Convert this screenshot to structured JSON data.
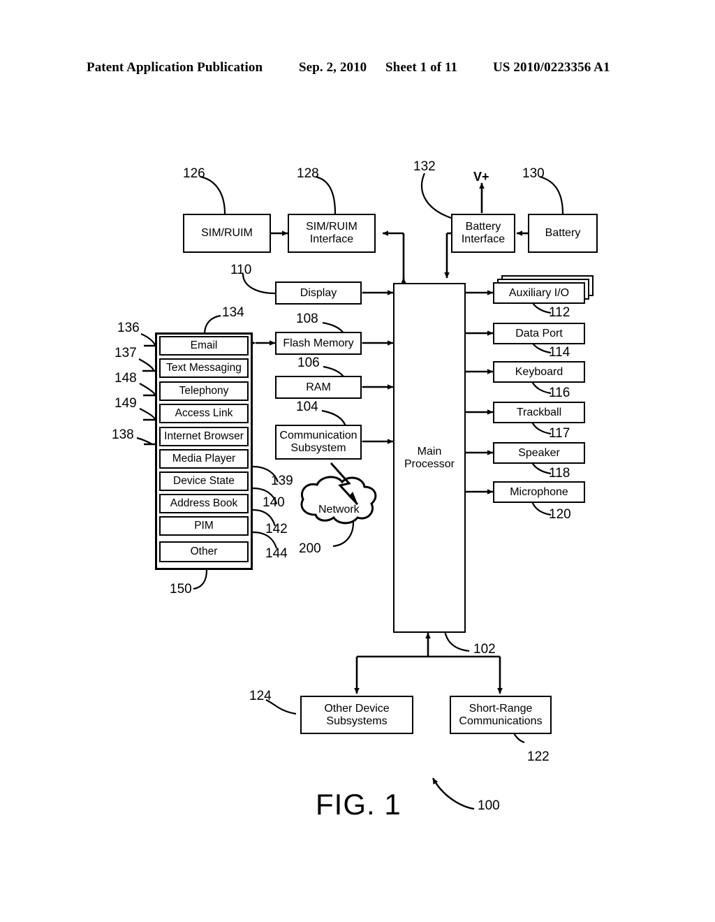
{
  "header": {
    "publication": "Patent Application Publication",
    "date": "Sep. 2, 2010",
    "sheet": "Sheet 1 of 11",
    "patent_number": "US 2010/0223356 A1"
  },
  "figure": {
    "caption": "FIG. 1",
    "caption_ref": "100",
    "v_plus_label": "V+",
    "cloud_label": "Network",
    "cloud_ref": "200"
  },
  "top_row": [
    {
      "label": "SIM/RUIM",
      "ref": "126"
    },
    {
      "label": "SIM/RUIM\nInterface",
      "ref": "128",
      "line1": "SIM/RUIM",
      "line2": "Interface"
    },
    {
      "label": "Battery\nInterface",
      "ref": "132",
      "line1": "Battery",
      "line2": "Interface"
    },
    {
      "label": "Battery",
      "ref": "130"
    }
  ],
  "processor": {
    "line1": "Main",
    "line2": "Processor",
    "ref": "102"
  },
  "middle_column": [
    {
      "label": "Display",
      "ref": "110"
    },
    {
      "label": "Flash Memory",
      "ref": "108"
    },
    {
      "label": "RAM",
      "ref": "106"
    },
    {
      "label": "Communication Subsystem",
      "ref": "104",
      "line1": "Communication",
      "line2": "Subsystem"
    }
  ],
  "right_column": [
    {
      "label": "Auxiliary I/O",
      "ref": "112",
      "stacked": true
    },
    {
      "label": "Data Port",
      "ref": "114",
      "stacked": false
    },
    {
      "label": "Keyboard",
      "ref": "116",
      "stacked": false
    },
    {
      "label": "Trackball",
      "ref": "117",
      "stacked": false
    },
    {
      "label": "Speaker",
      "ref": "118",
      "stacked": false
    },
    {
      "label": "Microphone",
      "ref": "120",
      "stacked": false
    }
  ],
  "applications": {
    "container_ref": "134",
    "bottom_ref": "150",
    "items": [
      {
        "label": "Email",
        "ref": "136",
        "ref_side": "left"
      },
      {
        "label": "Text Messaging",
        "ref": "137",
        "ref_side": "left"
      },
      {
        "label": "Telephony",
        "ref": "148",
        "ref_side": "left"
      },
      {
        "label": "Access Link",
        "ref": "149",
        "ref_side": "left"
      },
      {
        "label": "Internet Browser",
        "ref": "138",
        "ref_side": "left"
      },
      {
        "label": "Media Player",
        "ref": "139",
        "ref_side": "right"
      },
      {
        "label": "Device State",
        "ref": "140",
        "ref_side": "right"
      },
      {
        "label": "Address Book",
        "ref": "142",
        "ref_side": "right"
      },
      {
        "label": "PIM",
        "ref": "144",
        "ref_side": "right"
      },
      {
        "label": "Other",
        "ref": "",
        "ref_side": "none"
      }
    ]
  },
  "bottom_row": [
    {
      "label": "Other Device Subsystems",
      "ref": "124",
      "line1": "Other Device",
      "line2": "Subsystems"
    },
    {
      "label": "Short-Range Communications",
      "ref": "122",
      "line1": "Short-Range",
      "line2": "Communications"
    }
  ]
}
